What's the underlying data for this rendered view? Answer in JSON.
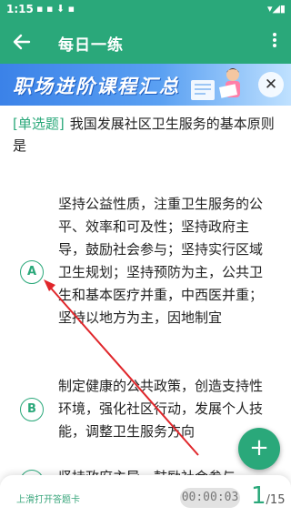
{
  "status_bar": {
    "time": "1:15",
    "left_icons": "▪ ▪ ⬇ ▪",
    "right_icons": "▾◢▮"
  },
  "app_bar": {
    "title": "每日一练"
  },
  "banner": {
    "title": "职场进阶课程汇总"
  },
  "question": {
    "type_label": "[单选题]",
    "text": "我国发展社区卫生服务的基本原则是"
  },
  "options": [
    {
      "letter": "A",
      "text": "坚持公益性质，注重卫生服务的公平、效率和可及性；坚持政府主导，鼓励社会参与；坚持实行区域卫生规划；坚持预防为主，公共卫生和基本医疗并重，中西医并重；坚持以地方为主，因地制宜"
    },
    {
      "letter": "B",
      "text": "制定健康的公共政策，创造支持性环境，强化社区行动，发展个人技能，调整卫生服务方向"
    },
    {
      "letter": "C",
      "text": "坚持政府主导，鼓励社会参与"
    }
  ],
  "fab": {
    "label": "+"
  },
  "bottom": {
    "hint": "上滑打开答题卡",
    "timer": "00:00:03",
    "page_current": "1",
    "page_total": "/15"
  },
  "colors": {
    "accent": "#2aa87a",
    "banner": "#3b82e8",
    "annotation": "#e0262b"
  }
}
